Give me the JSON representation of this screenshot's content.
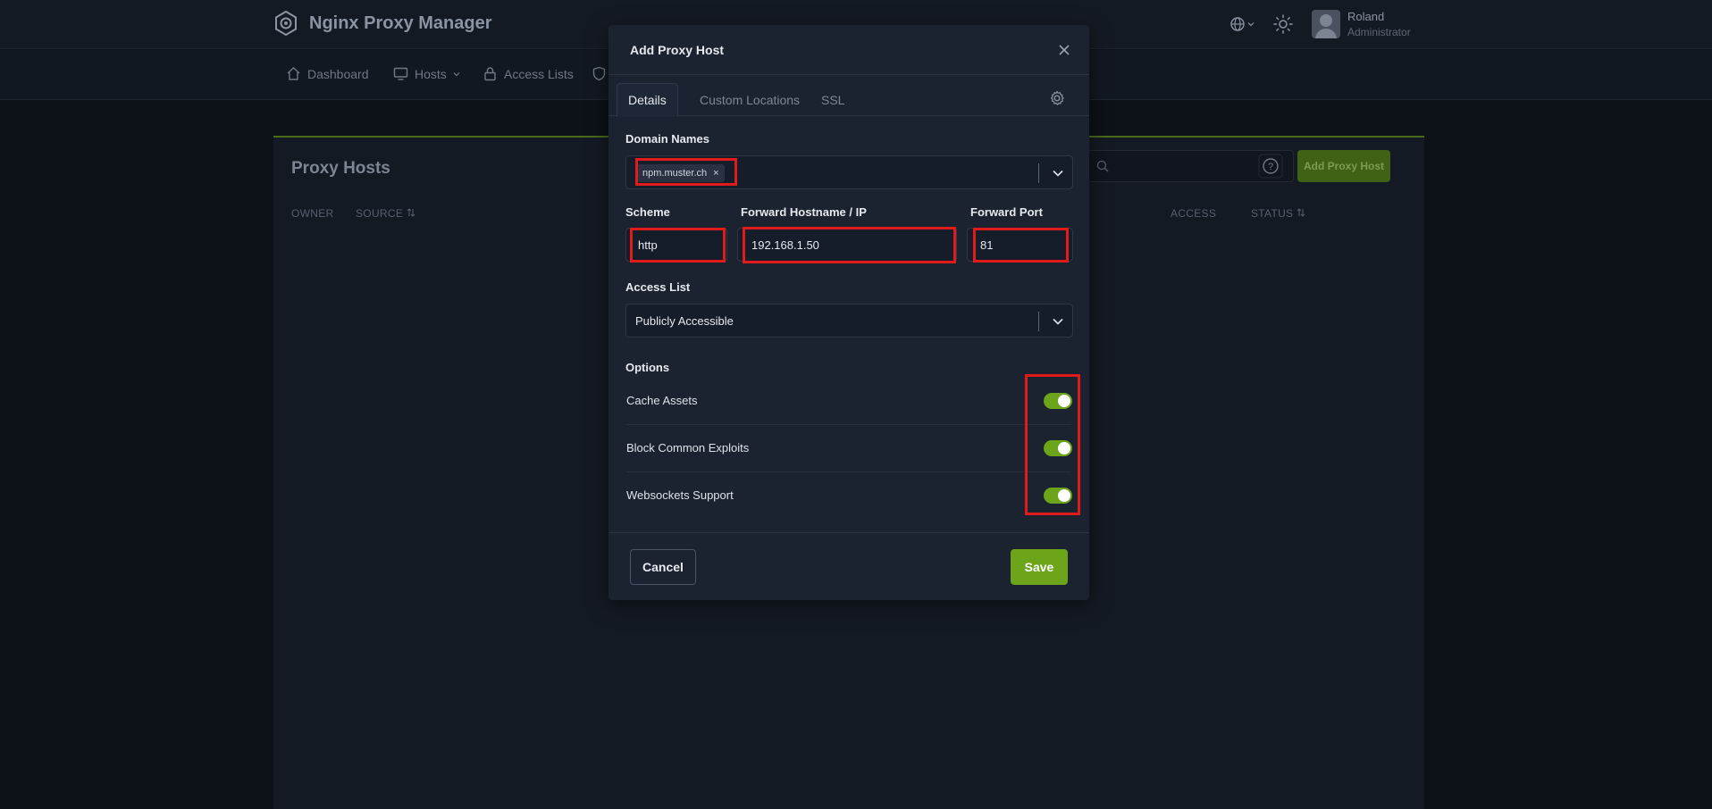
{
  "app": {
    "title": "Nginx Proxy Manager",
    "user_name": "Roland",
    "user_role": "Administrator"
  },
  "nav": {
    "dashboard": "Dashboard",
    "hosts": "Hosts",
    "access_lists": "Access Lists"
  },
  "page": {
    "title": "Proxy Hosts",
    "add_button": "Add Proxy Host",
    "columns": {
      "owner": "OWNER",
      "source": "SOURCE",
      "access": "ACCESS",
      "status": "STATUS"
    }
  },
  "modal": {
    "title": "Add Proxy Host",
    "tabs": {
      "details": "Details",
      "custom_locations": "Custom Locations",
      "ssl": "SSL"
    },
    "domain_names_label": "Domain Names",
    "domain_chip": "npm.muster.ch",
    "chip_remove": "×",
    "scheme_label": "Scheme",
    "scheme_value": "http",
    "forward_host_label": "Forward Hostname / IP",
    "forward_host_value": "192.168.1.50",
    "forward_port_label": "Forward Port",
    "forward_port_value": "81",
    "access_list_label": "Access List",
    "access_list_value": "Publicly Accessible",
    "options_label": "Options",
    "options": {
      "cache_assets": "Cache Assets",
      "block_exploits": "Block Common Exploits",
      "websockets": "Websockets Support"
    },
    "cancel": "Cancel",
    "save": "Save"
  },
  "colors": {
    "accent": "#6ca41a",
    "highlight": "#e11a1a",
    "modal_bg": "#1b2230",
    "page_bg": "#0d1118"
  },
  "icons": [
    "logo-icon",
    "globe-icon",
    "sun-icon",
    "home-icon",
    "monitor-icon",
    "lock-icon",
    "shield-icon",
    "close-icon",
    "gear-icon",
    "chevron-down-icon",
    "help-icon",
    "search-icon",
    "sort-icon"
  ]
}
